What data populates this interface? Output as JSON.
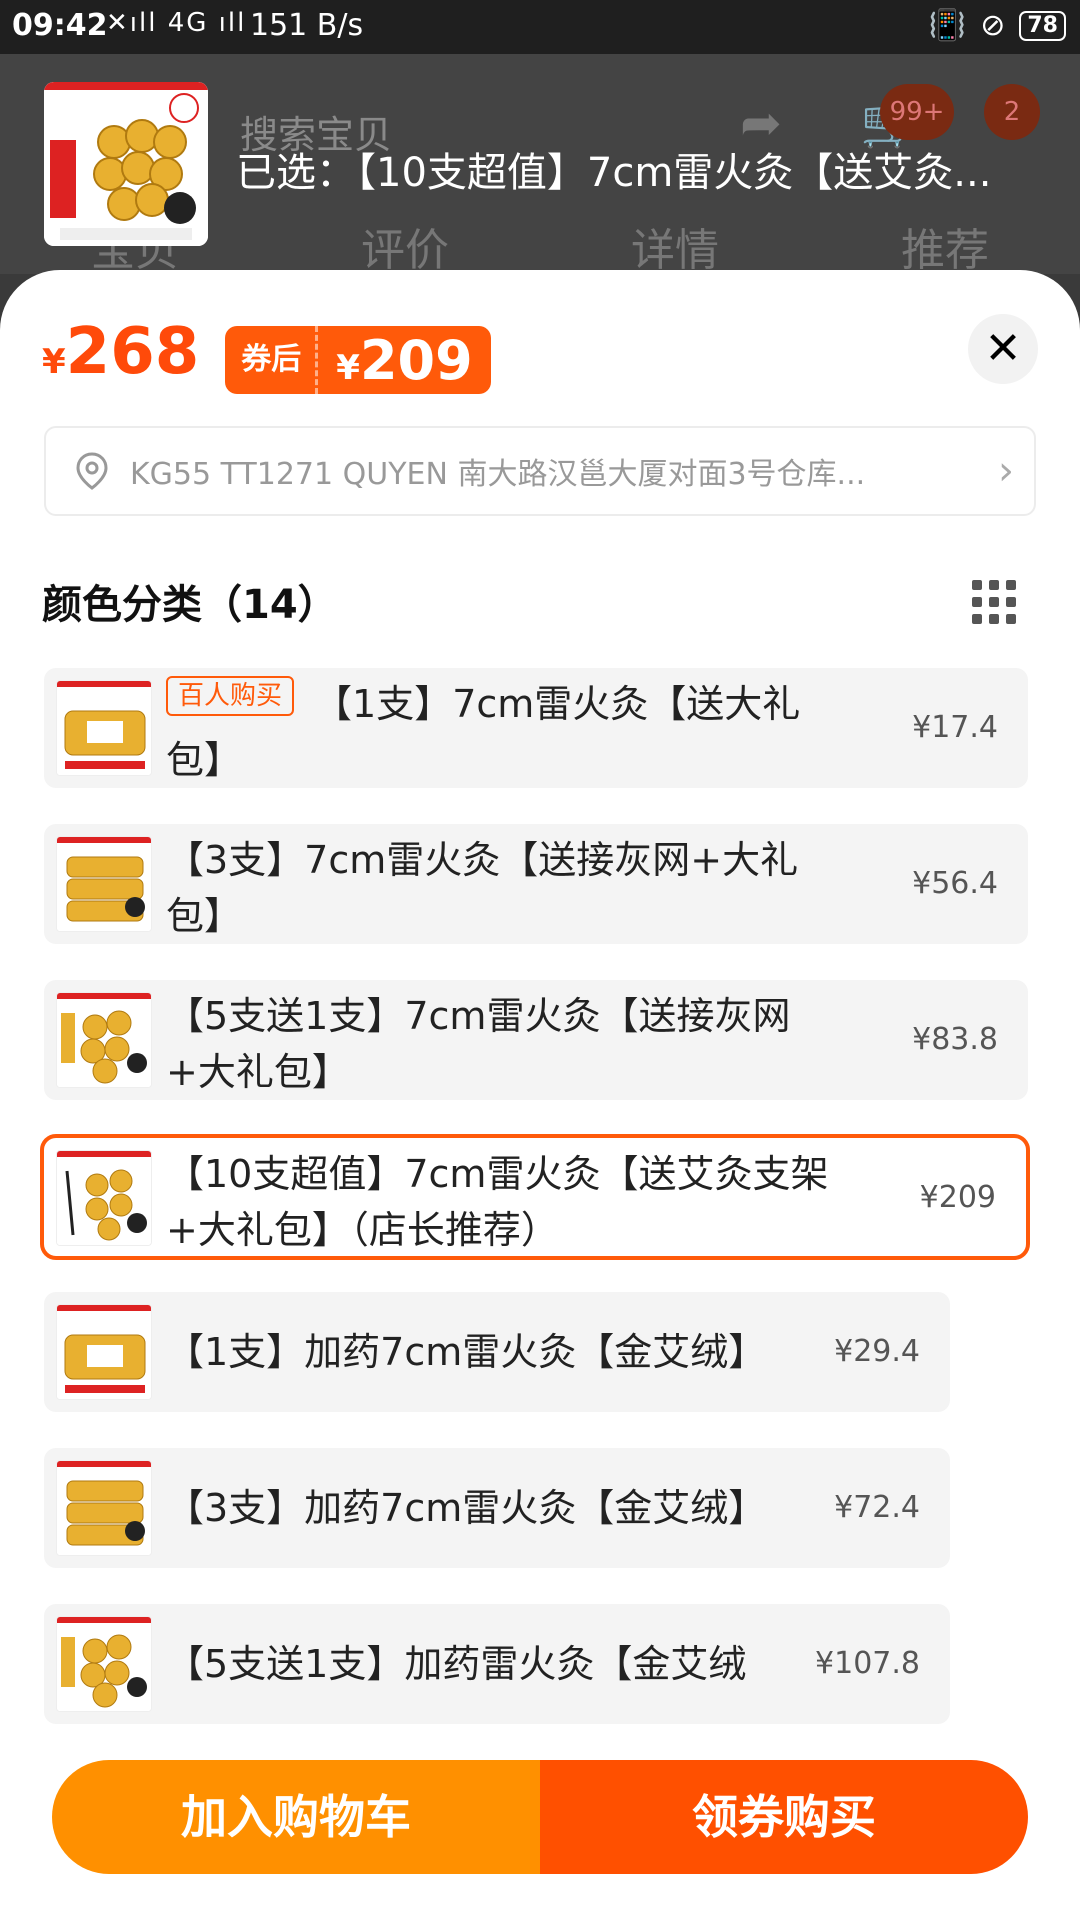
{
  "status_bar": {
    "time": "09:42",
    "signal": "✕ıll 4G ıll",
    "network_speed": "151 B/s",
    "battery": "78"
  },
  "background": {
    "search_placeholder": "搜索宝贝",
    "cart_badge": "99+",
    "message_badge": "2",
    "tabs": [
      "宝贝",
      "评价",
      "详情",
      "推荐"
    ]
  },
  "header": {
    "selected_text": "已选：【10支超值】7cm雷火灸【送艾灸..."
  },
  "price": {
    "currency": "¥",
    "original": "268",
    "coupon_label": "券后",
    "after_coupon": "209"
  },
  "address": {
    "text": "KG55 TT1271 QUYEN 南大路汉邕大厦对面3号仓库..."
  },
  "variants": {
    "title": "颜色分类（14）",
    "items": [
      {
        "tag": "百人购买",
        "label": "【1支】7cm雷火灸【送大礼包】",
        "price": "¥17.4"
      },
      {
        "tag": "",
        "label": "【3支】7cm雷火灸【送接灰网+大礼包】",
        "price": "¥56.4"
      },
      {
        "tag": "",
        "label": "【5支送1支】7cm雷火灸【送接灰网+大礼包】",
        "price": "¥83.8"
      },
      {
        "tag": "",
        "label": "【10支超值】7cm雷火灸【送艾灸支架+大礼包】（店长推荐）",
        "price": "¥209"
      },
      {
        "tag": "",
        "label": "【1支】加药7cm雷火灸【金艾绒】",
        "price": "¥29.4"
      },
      {
        "tag": "",
        "label": "【3支】加药7cm雷火灸【金艾绒】",
        "price": "¥72.4"
      },
      {
        "tag": "",
        "label": "【5支送1支】加药雷火灸【金艾绒",
        "price": "¥107.8"
      }
    ]
  },
  "actions": {
    "add_to_cart": "加入购物车",
    "buy_with_coupon": "领券购买"
  },
  "colors": {
    "accent": "#ff5a0a",
    "cart_button": "#ff9000",
    "buy_button": "#ff5000"
  }
}
